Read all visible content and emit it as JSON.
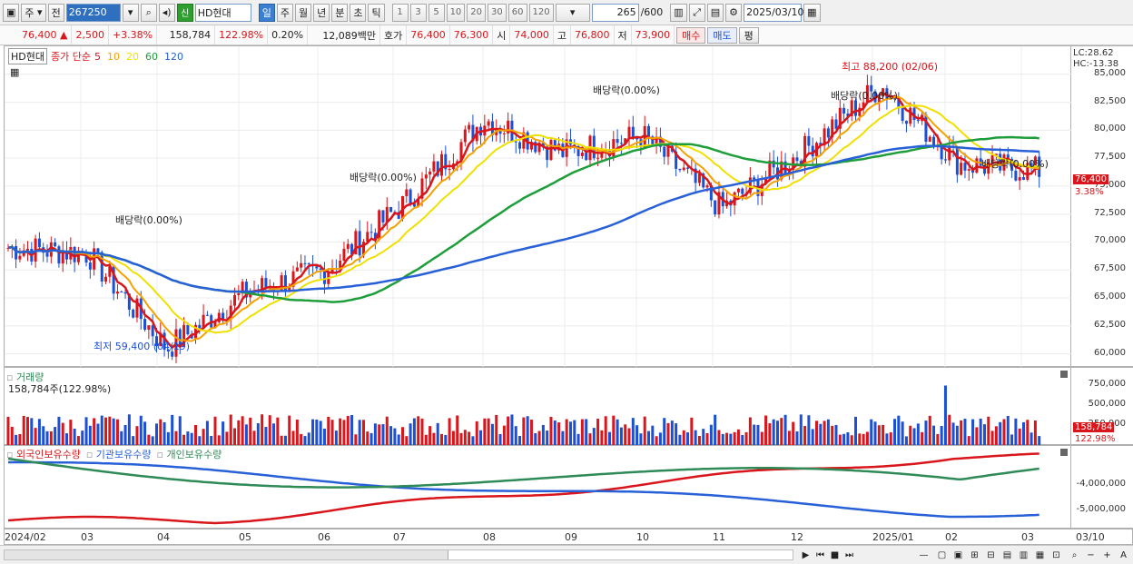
{
  "toolbar": {
    "period_select": "주",
    "period_label": "전",
    "code": "267250",
    "sin_badge": "신",
    "stock_name": "HD현대",
    "timeframes": [
      "일",
      "주",
      "월",
      "년",
      "분",
      "초",
      "틱"
    ],
    "active_timeframe": "일",
    "intervals": [
      "1",
      "3",
      "5",
      "10",
      "20",
      "30",
      "60",
      "120"
    ],
    "range": "265",
    "range_total": "/600",
    "date": "2025/03/10"
  },
  "quote": {
    "price": "76,400",
    "arrow": "▲",
    "change": "2,500",
    "change_pct": "+3.38%",
    "volume": "158,784",
    "vol_ratio": "122.98%",
    "turnover_pct": "0.20%",
    "amount": "12,089백만",
    "hoga_label": "호가",
    "hoga1": "76,400",
    "hoga2": "76,300",
    "open_label": "시",
    "open": "74,000",
    "high_label": "고",
    "high": "76,800",
    "low_label": "저",
    "low": "73,900",
    "buy_label": "매수",
    "sell_label": "매도",
    "flat_label": "평"
  },
  "price_pane": {
    "name_box": "HD현대",
    "legend_prefix": "종가 단순",
    "ma": [
      {
        "label": "5",
        "color": "#d8161b"
      },
      {
        "label": "10",
        "color": "#f5a100"
      },
      {
        "label": "20",
        "color": "#f0e000"
      },
      {
        "label": "60",
        "color": "#1e9e3a"
      },
      {
        "label": "120",
        "color": "#2860d8"
      }
    ],
    "lc": "LC:28.62",
    "hc": "HC:-13.38",
    "y_ticks": [
      "85,000",
      "82,500",
      "80,000",
      "77,500",
      "75,000",
      "72,500",
      "70,000",
      "67,500",
      "65,000",
      "62,500",
      "60,000"
    ],
    "current_price_tag": "76,400",
    "current_pct_tag": "3.38%",
    "annotations": {
      "high": "최고 88,200 (02/06)",
      "low": "최저 59,400 (04/19)",
      "div1": "배당락(0.00%)",
      "div2": "배당락(0.00%)",
      "div3": "배당락(0.00%)",
      "div4": "배당락(0.00%)",
      "div5": "배당락(0.00%)"
    }
  },
  "volume_pane": {
    "title": "거래량",
    "value": "158,784주(122.98%)",
    "y_ticks": [
      "750,000",
      "500,000",
      "250,000"
    ],
    "tag_value": "158,784",
    "tag_pct": "122.98%"
  },
  "holder_pane": {
    "legend": [
      "외국인보유수량",
      "기관보유수량",
      "개인보유수량"
    ],
    "colors": [
      "#d8161b",
      "#2860d8",
      "#2e8b57"
    ],
    "y_ticks": [
      "-4,000,000",
      "-5,000,000"
    ]
  },
  "x_axis": [
    "2024/02",
    "03",
    "04",
    "05",
    "06",
    "07",
    "08",
    "09",
    "10",
    "11",
    "12",
    "2025/01",
    "02",
    "03",
    "03/10"
  ],
  "chart_data": {
    "type": "candlestick",
    "title": "HD현대",
    "ylim": [
      58750,
      87500
    ],
    "y_ticks": [
      60000,
      62500,
      65000,
      67500,
      70000,
      72500,
      75000,
      77500,
      80000,
      82500,
      85000
    ],
    "close_series": [
      {
        "x": "2024/02",
        "y": 69500
      },
      {
        "x": "2024/03",
        "y": 69000
      },
      {
        "x": "2024/04",
        "y": 60500
      },
      {
        "x": "2024/05",
        "y": 65500
      },
      {
        "x": "2024/06",
        "y": 67500
      },
      {
        "x": "2024/07",
        "y": 73500
      },
      {
        "x": "2024/08",
        "y": 81000
      },
      {
        "x": "2024/09",
        "y": 78000
      },
      {
        "x": "2024/10",
        "y": 79500
      },
      {
        "x": "2024/11",
        "y": 73000
      },
      {
        "x": "2024/12",
        "y": 78000
      },
      {
        "x": "2025/01",
        "y": 84000
      },
      {
        "x": "2025/02",
        "y": 77000
      },
      {
        "x": "2025/03/10",
        "y": 76400
      }
    ],
    "high": {
      "value": 88200,
      "date": "02/06"
    },
    "low": {
      "value": 59400,
      "date": "04/19"
    }
  }
}
